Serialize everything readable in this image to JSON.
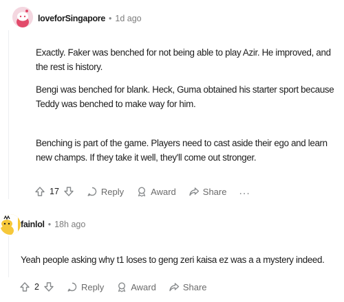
{
  "comments": [
    {
      "username": "loveforSingapore",
      "separator": "•",
      "time": "1d ago",
      "paragraphs": [
        "Exactly. Faker was benched for not being able to play Azir. He improved, and the rest is history.",
        "Bengi was benched for blank. Heck, Guma obtained his starter sport because Teddy was benched to make way for him.",
        "Benching is part of the game. Players need to cast aside their ego and learn new champs. If they take it well, they'll come out stronger."
      ],
      "votes": "17",
      "reply_label": "Reply",
      "award_label": "Award",
      "share_label": "Share",
      "more_label": "..."
    },
    {
      "username": "fainlol",
      "separator": "•",
      "time": "18h ago",
      "paragraphs": [
        "Yeah people asking why t1 loses to geng zeri kaisa ez was a a mystery indeed."
      ],
      "votes": "2",
      "reply_label": "Reply",
      "award_label": "Award",
      "share_label": "Share"
    }
  ],
  "colors": {
    "avatar_1_bg": "#f4d7e0",
    "avatar_1_fg": "#e24a6a",
    "avatar_2_bg": "#f6c83a",
    "meta_gray": "#7c7c7c"
  },
  "icons": [
    "upvote-icon",
    "downvote-icon",
    "reply-icon",
    "award-icon",
    "share-icon",
    "more-icon"
  ]
}
